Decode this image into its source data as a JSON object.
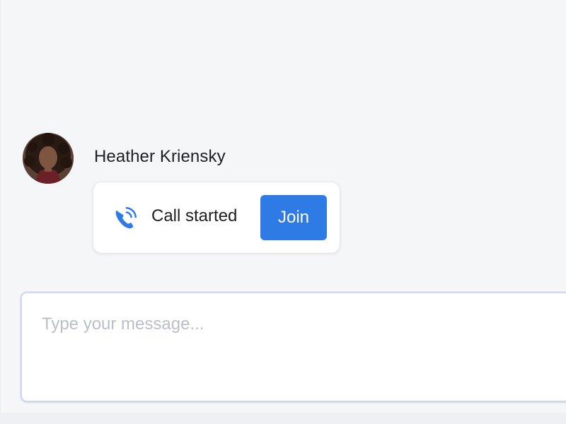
{
  "message": {
    "sender_name": "Heather Kriensky",
    "avatar_alt": "Heather Kriensky",
    "call_card": {
      "icon": "phone-call-icon",
      "status_text": "Call started",
      "join_label": "Join"
    }
  },
  "composer": {
    "placeholder": "Type your message...",
    "value": ""
  },
  "colors": {
    "accent": "#2f7be5",
    "background": "#f5f6f8",
    "card": "#ffffff",
    "text": "#1d1f24",
    "placeholder": "#b9bfca"
  }
}
